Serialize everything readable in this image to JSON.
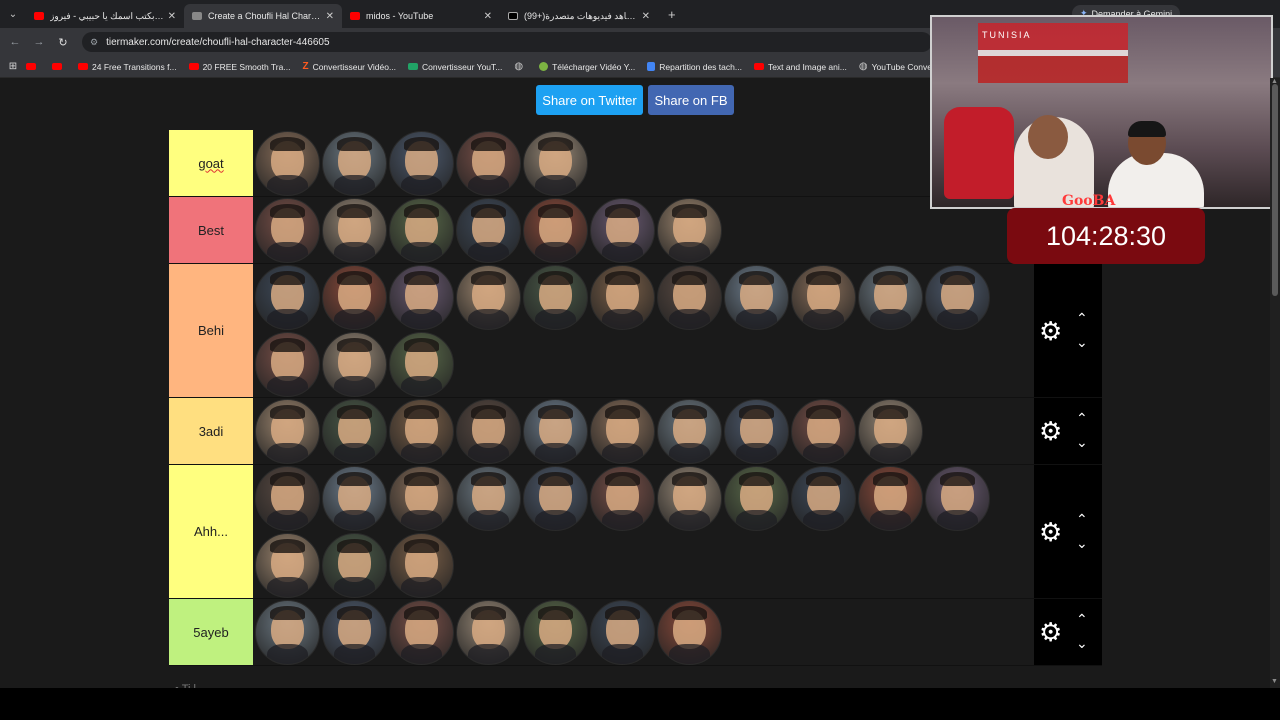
{
  "browser": {
    "tabs": [
      {
        "label": "بكتب اسمك يا حبيبي - فيروز | ube",
        "icon": "youtube-icon",
        "active": false
      },
      {
        "label": "Create a Choufli Hal Character",
        "icon": "tiermaker-icon",
        "active": true
      },
      {
        "label": "midos - YouTube",
        "icon": "youtube-icon",
        "active": false
      },
      {
        "label": "(99+)شاهد فيديوهات متصدرة | k",
        "icon": "tiktok-icon",
        "active": false
      }
    ],
    "new_tab": "+",
    "gemini_label": "Demander à Gemini",
    "url": "tiermaker.com/create/choufli-hal-character-446605",
    "bookmarks": [
      {
        "label": "",
        "icon": "youtube-icon"
      },
      {
        "label": "",
        "icon": "youtube-icon"
      },
      {
        "label": "24 Free Transitions f...",
        "icon": "youtube-icon"
      },
      {
        "label": "20 FREE Smooth Tra...",
        "icon": "youtube-icon"
      },
      {
        "label": "Convertisseur Vidéo...",
        "icon": "z-icon"
      },
      {
        "label": "Convertisseur YouT...",
        "icon": "green-icon"
      },
      {
        "label": "",
        "icon": "globe-icon"
      },
      {
        "label": "Télécharger Vidéo Y...",
        "icon": "download-icon"
      },
      {
        "label": "Repartition des tach...",
        "icon": "docs-icon"
      },
      {
        "label": "Text and Image ani...",
        "icon": "youtube-icon"
      },
      {
        "label": "YouTube Converter...",
        "icon": "globe-icon"
      }
    ]
  },
  "share": {
    "twitter": "Share on Twitter",
    "facebook": "Share on FB"
  },
  "tiers": [
    {
      "label": "goat",
      "color": "#ffff7f",
      "count": 5,
      "height": 67,
      "controls": false,
      "wavy": true
    },
    {
      "label": "Best",
      "color": "#f0737a",
      "count": 7,
      "height": 67,
      "controls": false,
      "wavy": false
    },
    {
      "label": "Behi",
      "color": "#ffb57f",
      "count": 14,
      "height": 134,
      "controls": true,
      "wavy": false
    },
    {
      "label": "3adi",
      "color": "#ffdf80",
      "count": 10,
      "height": 67,
      "controls": true,
      "wavy": false
    },
    {
      "label": "Ahh...",
      "color": "#ffff7f",
      "count": 14,
      "height": 134,
      "controls": true,
      "wavy": false
    },
    {
      "label": "5ayeb",
      "color": "#bff17f",
      "count": 7,
      "height": 67,
      "controls": true,
      "wavy": false
    }
  ],
  "overlay": {
    "flag_text": "TUNISIA",
    "logo": "GooBA",
    "timer": "104:28:30"
  },
  "below_text": "• Ti l"
}
